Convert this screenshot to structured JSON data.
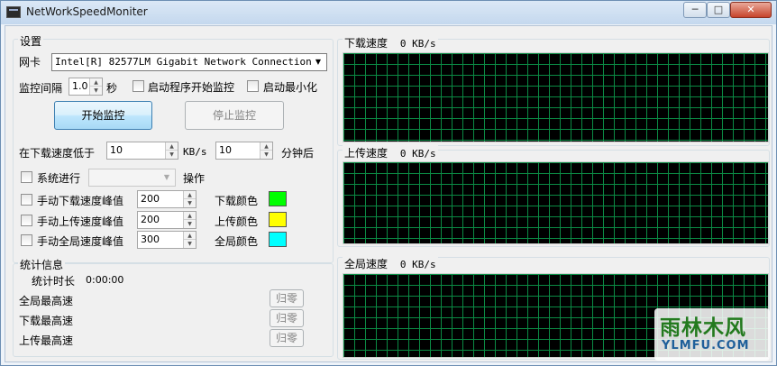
{
  "window": {
    "title": "NetWorkSpeedMoniter",
    "min_glyph": "─",
    "max_glyph": "□",
    "close_glyph": "✕"
  },
  "settings": {
    "group_label": "设置",
    "nic_label": "网卡",
    "nic_value": "Intel[R] 82577LM Gigabit Network Connection",
    "interval_label": "监控间隔",
    "interval_value": "1.0",
    "interval_unit": "秒",
    "start_on_launch_label": "启动程序开始监控",
    "start_minimized_label": "启动最小化",
    "start_button": "开始监控",
    "stop_button": "停止监控",
    "low_speed_label": "在下载速度低于",
    "low_speed_value": "10",
    "low_speed_unit": "KB/s",
    "minutes_value": "10",
    "minutes_label": "分钟后",
    "system_label": "系统进行",
    "system_action_value": "",
    "action_label": "操作",
    "peak_rows": [
      {
        "label": "手动下载速度峰值",
        "value": "200",
        "color_label": "下载颜色",
        "color": "#00ff00"
      },
      {
        "label": "手动上传速度峰值",
        "value": "200",
        "color_label": "上传颜色",
        "color": "#ffff00"
      },
      {
        "label": "手动全局速度峰值",
        "value": "300",
        "color_label": "全局颜色",
        "color": "#00ffff"
      }
    ]
  },
  "stats": {
    "group_label": "统计信息",
    "duration_label": "统计时长",
    "duration_value": "0:00:00",
    "rows": [
      {
        "label": "全局最高速",
        "button": "归零"
      },
      {
        "label": "下载最高速",
        "button": "归零"
      },
      {
        "label": "上传最高速",
        "button": "归零"
      }
    ]
  },
  "graphs": [
    {
      "label": "下载速度",
      "value": "0 KB/s"
    },
    {
      "label": "上传速度",
      "value": "0 KB/s"
    },
    {
      "label": "全局速度",
      "value": "0 KB/s"
    }
  ],
  "colors": {
    "graph_bg": "#000000",
    "grid": "#0b8a44"
  },
  "watermark": {
    "main": "雨林木风",
    "url": "YLMFU.COM"
  }
}
